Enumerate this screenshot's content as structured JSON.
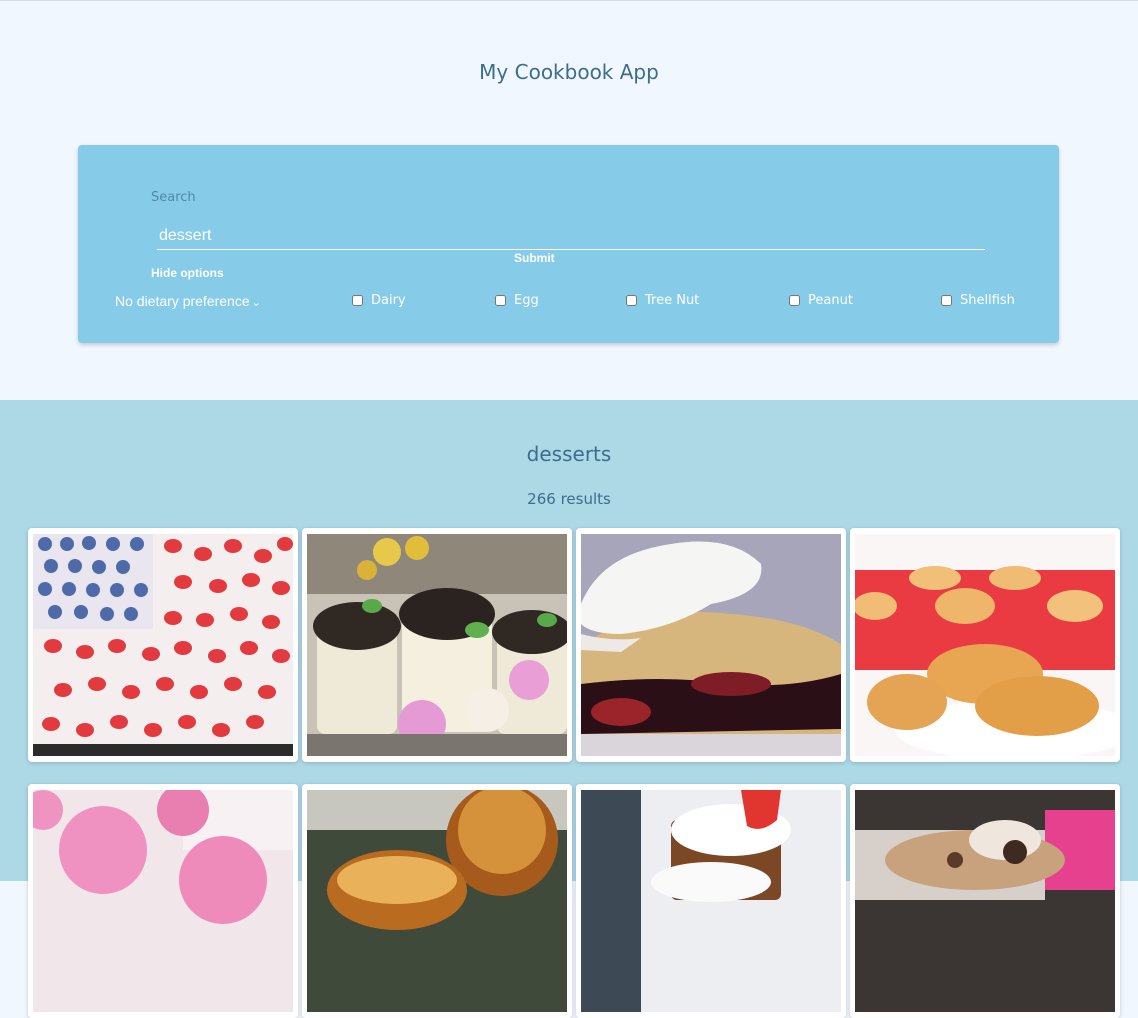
{
  "header": {
    "title": "My Cookbook App"
  },
  "search": {
    "label": "Search",
    "value": "dessert",
    "submit_label": "Submit",
    "toggle_options_label": "Hide options",
    "diet_selected": "No dietary preference",
    "allergens": [
      {
        "label": "Dairy",
        "checked": false
      },
      {
        "label": "Egg",
        "checked": false
      },
      {
        "label": "Tree Nut",
        "checked": false
      },
      {
        "label": "Peanut",
        "checked": false
      },
      {
        "label": "Shellfish",
        "checked": false
      }
    ]
  },
  "results": {
    "title": "desserts",
    "count_text": "266 results",
    "recipes": [
      {
        "image": "strawberry-blueberry-flag-cake-photo"
      },
      {
        "image": "dirt-pudding-cups-with-roses-photo"
      },
      {
        "image": "cobbler-with-whipped-cream-photo"
      },
      {
        "image": "madeleines-photo"
      },
      {
        "image": "pink-glazed-donuts-photo"
      },
      {
        "image": "baked-apple-photo"
      },
      {
        "image": "gingerbread-shortcake-with-strawberry-photo"
      },
      {
        "image": "toffee-crumble-dessert-photo"
      }
    ]
  }
}
